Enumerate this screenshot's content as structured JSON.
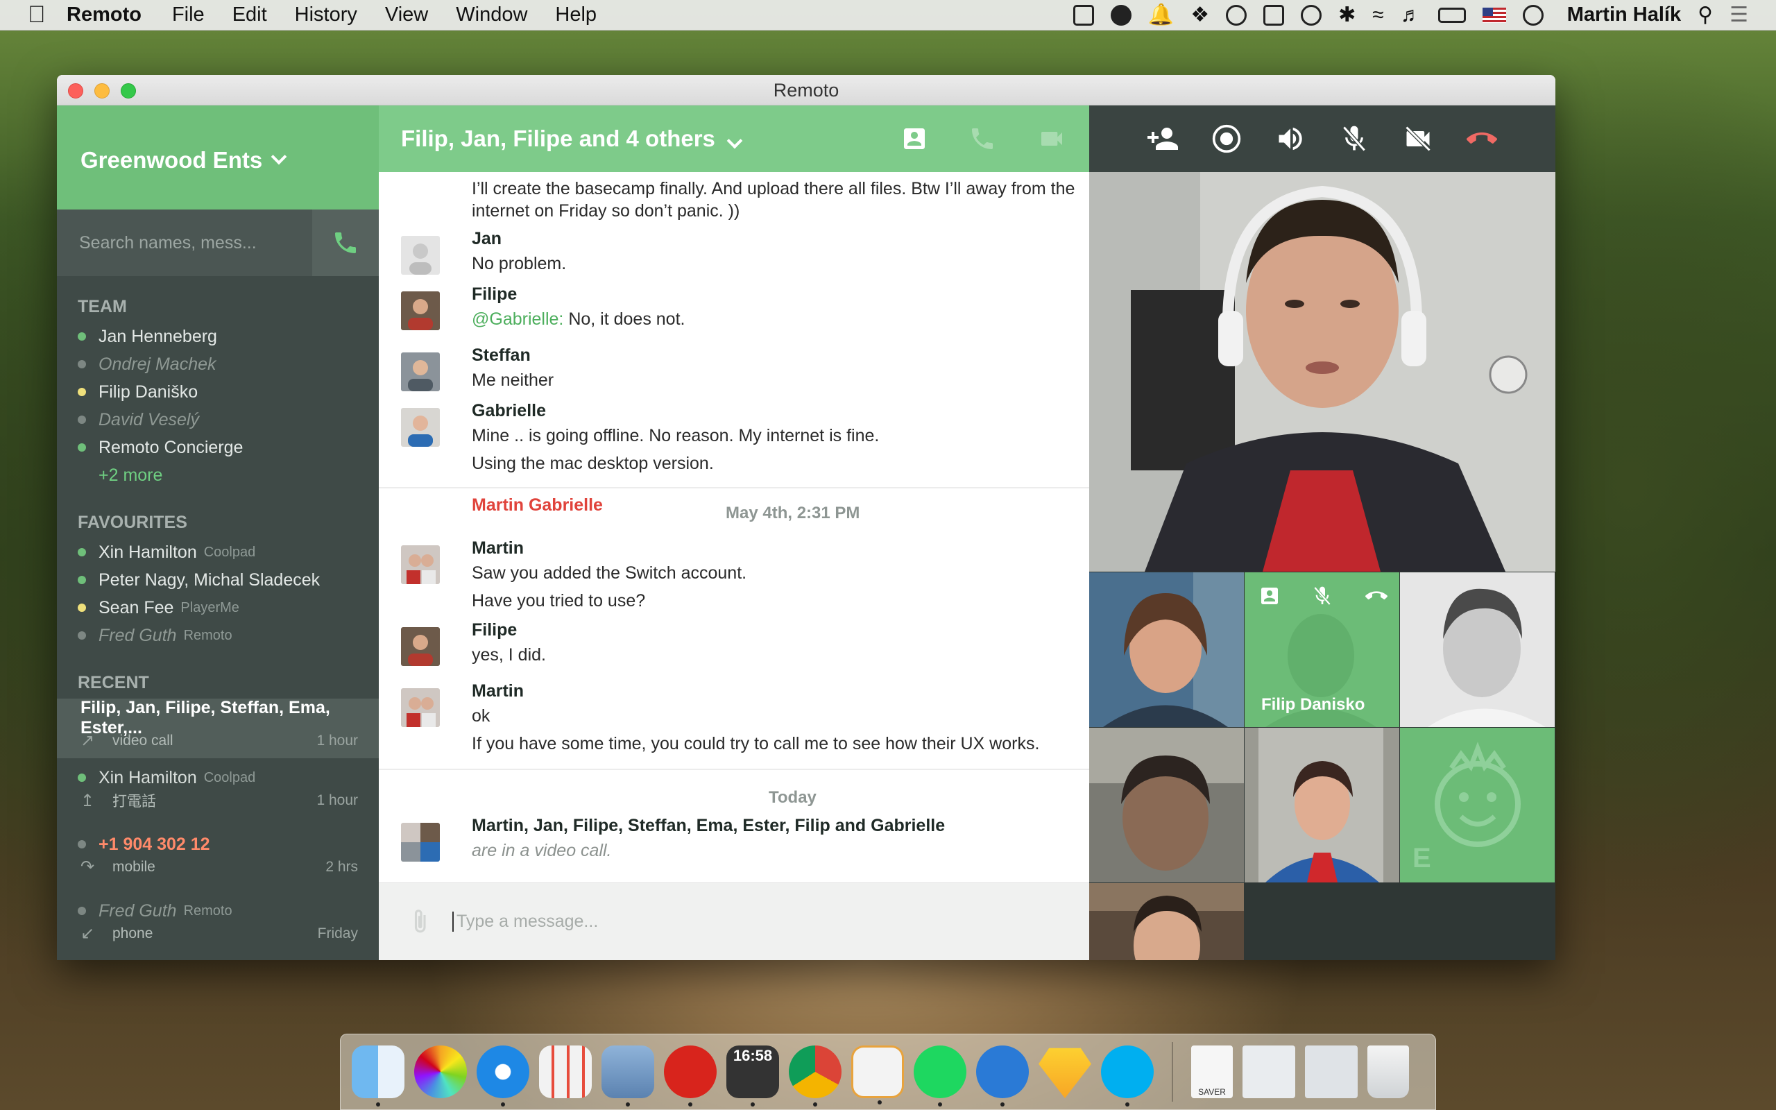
{
  "menubar": {
    "app_name": "Remoto",
    "menus": [
      "File",
      "Edit",
      "History",
      "View",
      "Window",
      "Help"
    ],
    "user": "Martin Halík"
  },
  "window": {
    "title": "Remoto"
  },
  "sidebar": {
    "workspace": "Greenwood Ents",
    "search_placeholder": "Search names, mess...",
    "team_title": "TEAM",
    "team": [
      {
        "name": "Jan Henneberg",
        "status": "online"
      },
      {
        "name": "Ondrej Machek",
        "status": "offline"
      },
      {
        "name": "Filip Daniško",
        "status": "away"
      },
      {
        "name": "David Veselý",
        "status": "offline"
      },
      {
        "name": "Remoto Concierge",
        "status": "online"
      }
    ],
    "team_more": "+2 more",
    "favourites_title": "FAVOURITES",
    "favourites": [
      {
        "name": "Xin Hamilton",
        "sub": "Coolpad",
        "status": "online"
      },
      {
        "name": "Peter Nagy, Michal Sladecek",
        "sub": "",
        "status": "online"
      },
      {
        "name": "Sean Fee",
        "sub": "PlayerMe",
        "status": "away"
      },
      {
        "name": "Fred Guth",
        "sub": "Remoto",
        "status": "offline"
      }
    ],
    "recent_title": "RECENT",
    "recent": [
      {
        "name": "Filip, Jan, Filipe, Steffan, Ema, Ester,...",
        "sub": "",
        "kind": "video call",
        "time": "1 hour"
      },
      {
        "name": "Xin Hamilton",
        "sub": "Coolpad",
        "kind": "打電話",
        "time": "1 hour"
      },
      {
        "name": "+1 904 302 12",
        "sub": "",
        "kind": "mobile",
        "time": "2 hrs"
      },
      {
        "name": "Fred Guth",
        "sub": "Remoto",
        "kind": "phone",
        "time": "Friday"
      }
    ]
  },
  "chat": {
    "title": "Filip, Jan, Filipe and 4 others",
    "messages": {
      "m0": {
        "lines": [
          "I’ll create the basecamp finally. And upload there all files. Btw I’ll away from the",
          "internet on Friday so don’t panic. ))"
        ]
      },
      "m1": {
        "author": "Jan",
        "lines": [
          "No problem."
        ]
      },
      "m2": {
        "author": "Filipe",
        "mention": "@Gabrielle:",
        "lines": [
          "No, it does not."
        ]
      },
      "m3": {
        "author": "Steffan",
        "lines": [
          "Me neither"
        ]
      },
      "m4": {
        "author": "Gabrielle",
        "lines": [
          "Mine .. is going offline. No reason. My internet is fine.",
          "Using the mac desktop version."
        ]
      },
      "m5": {
        "author": "Martin",
        "lines": [
          "Saw you added the Switch account.",
          "Have you tried to use?"
        ]
      },
      "m6": {
        "author": "Filipe",
        "lines": [
          "yes, I did."
        ]
      },
      "m7": {
        "author": "Martin",
        "lines": [
          "ok",
          "If you have some time, you could try to call me to see how their UX works."
        ]
      },
      "m8": {
        "author": "Martin, Jan, Filipe, Steffan, Ema, Ester, Filip and Gabrielle",
        "lines": [
          "are in a video call."
        ]
      }
    },
    "system_name": "Martin Gabrielle",
    "date_divider": "May 4th, 2:31 PM",
    "today_divider": "Today",
    "composer_placeholder": "Type a message..."
  },
  "video": {
    "focused_tile_label": "Filip Danisko",
    "avatar_letter": "E"
  },
  "dock": {
    "clock": "16:58",
    "saver_label": "SAVER"
  },
  "colors": {
    "accent_green": "#7ecb8a",
    "sidebar_bg": "#3f4a47",
    "hangup_red": "#f06a64",
    "mention_green": "#4cae5c",
    "system_red": "#e0433b"
  }
}
